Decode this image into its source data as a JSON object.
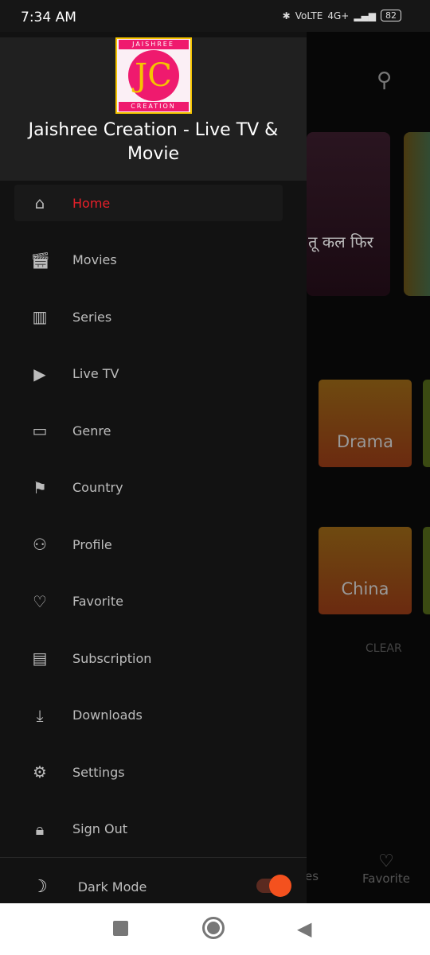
{
  "status": {
    "time": "7:34 AM",
    "signal": "4G+",
    "volte": "VoLTE",
    "battery": "82"
  },
  "app": {
    "title": "Jaishree Creation - Live TV & Movie",
    "logo_text_top": "JAISHREE",
    "logo_text_bottom": "CREATION",
    "logo_mark": "JC"
  },
  "menu": [
    {
      "label": "Home",
      "icon": "home-icon",
      "active": true
    },
    {
      "label": "Movies",
      "icon": "movie-icon"
    },
    {
      "label": "Series",
      "icon": "film-icon"
    },
    {
      "label": "Live TV",
      "icon": "tv-icon"
    },
    {
      "label": "Genre",
      "icon": "folder-icon"
    },
    {
      "label": "Country",
      "icon": "flag-icon"
    },
    {
      "label": "Profile",
      "icon": "person-icon"
    },
    {
      "label": "Favorite",
      "icon": "heart-icon"
    },
    {
      "label": "Subscription",
      "icon": "subscription-icon"
    },
    {
      "label": "Downloads",
      "icon": "download-icon"
    },
    {
      "label": "Settings",
      "icon": "gear-icon"
    },
    {
      "label": "Sign Out",
      "icon": "lock-icon"
    }
  ],
  "dark_mode": {
    "label": "Dark Mode",
    "on": true
  },
  "background": {
    "poster_text": "तू कल फिर",
    "genres": [
      "Drama",
      "China"
    ],
    "clear": "CLEAR",
    "nav_partial": "es",
    "nav_favorite": "Favorite"
  },
  "colors": {
    "accent": "#e8202a",
    "toggle": "#f4511e"
  }
}
